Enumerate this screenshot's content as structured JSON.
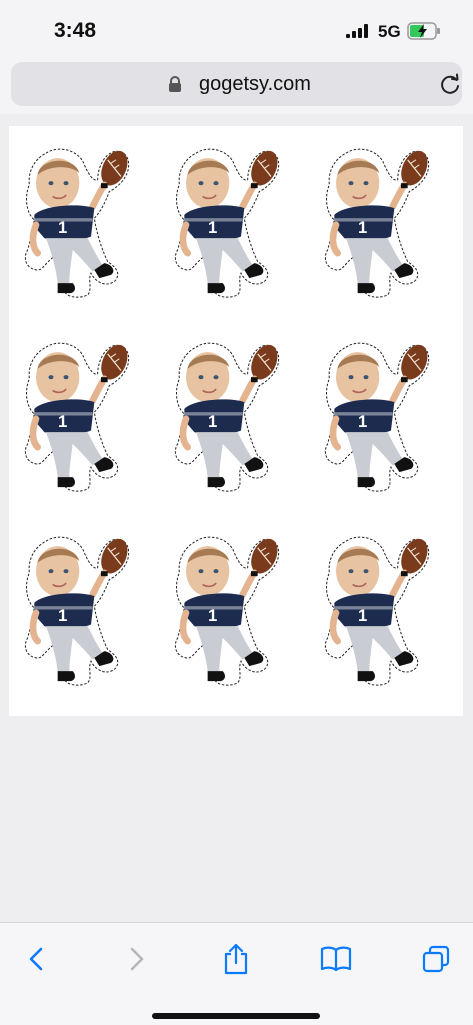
{
  "status": {
    "time": "3:48",
    "network": "5G",
    "battery_charging": true
  },
  "browser": {
    "url": "gogetsy.com"
  },
  "sheet": {
    "sticker_count": 9,
    "jersey_number": "1"
  },
  "colors": {
    "jersey": "#1d2b4f",
    "pants": "#c9ccd3",
    "football": "#7a3a1c",
    "accent": "#0a7aff"
  },
  "toolbar": {
    "icons": [
      "back-icon",
      "forward-icon",
      "share-icon",
      "bookmarks-icon",
      "tabs-icon"
    ]
  }
}
